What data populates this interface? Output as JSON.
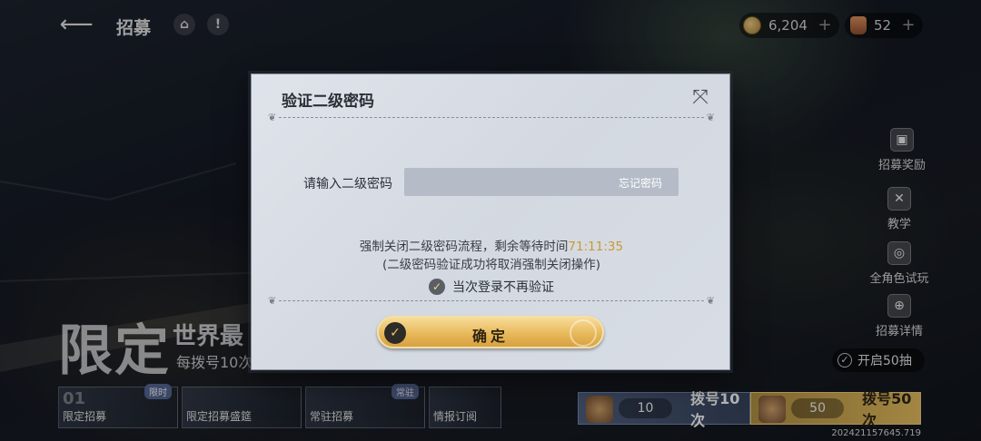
{
  "topbar": {
    "title": "招募",
    "back_icon": "arrow-left-icon",
    "home_icon": "home-icon",
    "alert_icon": "alert-icon",
    "coin_value": "6,204",
    "bag_value": "52",
    "plus": "+"
  },
  "side_menu": [
    {
      "label": "招募奖励",
      "icon": "gift-icon"
    },
    {
      "label": "教学",
      "icon": "tutorial-icon"
    },
    {
      "label": "全角色试玩",
      "icon": "gamepad-icon"
    },
    {
      "label": "招募详情",
      "icon": "zoom-in-icon"
    }
  ],
  "banner": {
    "title": "限定",
    "subtitle": "世界最",
    "subtitle2": "每拨号10次"
  },
  "open50": "开启50抽",
  "tabs": [
    {
      "num": "01",
      "label": "限定招募",
      "badge": "限时"
    },
    {
      "num": "",
      "label": "限定招募盛筵",
      "badge": ""
    },
    {
      "num": "",
      "label": "常驻招募",
      "badge": "常驻"
    },
    {
      "num": "",
      "label": "情报订阅",
      "badge": ""
    }
  ],
  "pull10": {
    "cost": "10",
    "label": "拨号10次"
  },
  "pull50": {
    "cost": "50",
    "label": "拨号50次"
  },
  "build_id": "202421157645.719",
  "dialog": {
    "title": "验证二级密码",
    "close_icon": "close-crossed-swords-icon",
    "input_label": "请输入二级密码",
    "input_value": "",
    "forgot_label": "忘记密码",
    "notice_line1": "强制关闭二级密码流程，剩余等待时间",
    "timer": "71:11:35",
    "notice_line2": "(二级密码验证成功将取消强制关闭操作)",
    "skip_label": "当次登录不再验证",
    "skip_checked": true,
    "confirm_label": "确定",
    "accent_color": "#c99a30"
  }
}
